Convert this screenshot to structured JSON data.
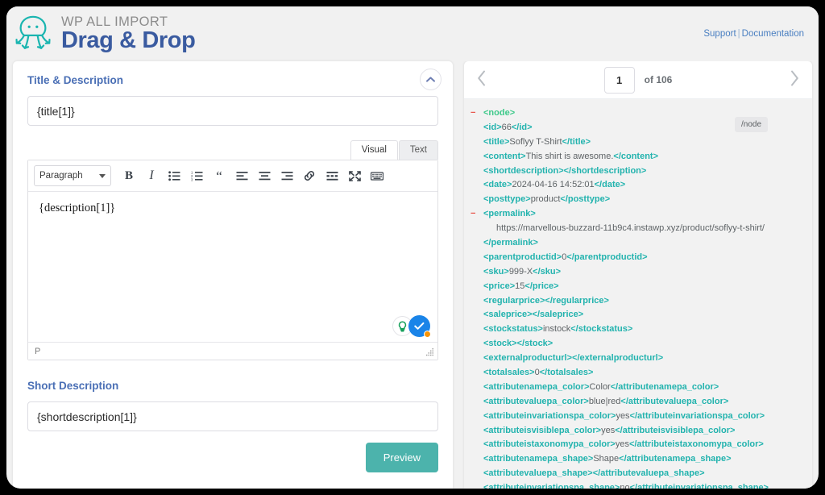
{
  "header": {
    "brand_top": "WP ALL IMPORT",
    "brand_main": "Drag & Drop",
    "logo_icon": "octopus-icon",
    "support_label": "Support",
    "separator": "|",
    "documentation_label": "Documentation"
  },
  "left_panel": {
    "section_title": "Title & Description",
    "collapse_icon": "chevron-up-icon",
    "title_field": {
      "value": "{title[1]}",
      "placeholder": ""
    },
    "editor": {
      "tabs": [
        {
          "label": "Visual",
          "active": true
        },
        {
          "label": "Text",
          "active": false
        }
      ],
      "format_select": {
        "value": "Paragraph",
        "caret_icon": "chevron-down-icon"
      },
      "toolbar_buttons": [
        {
          "name": "bold-icon",
          "label": "B"
        },
        {
          "name": "italic-icon",
          "label": "I"
        },
        {
          "name": "bulleted-list-icon",
          "label": ""
        },
        {
          "name": "numbered-list-icon",
          "label": ""
        },
        {
          "name": "blockquote-icon",
          "label": "“"
        },
        {
          "name": "align-left-icon",
          "label": ""
        },
        {
          "name": "align-center-icon",
          "label": ""
        },
        {
          "name": "align-right-icon",
          "label": ""
        },
        {
          "name": "link-icon",
          "label": ""
        },
        {
          "name": "insert-read-more-icon",
          "label": ""
        },
        {
          "name": "fullscreen-icon",
          "label": ""
        },
        {
          "name": "toolbar-toggle-icon",
          "label": ""
        }
      ],
      "content": "{description[1]}",
      "grammarly_bulb_icon": "lightbulb-icon",
      "grammarly_check_icon": "check-circle-icon",
      "status_path": "P",
      "resize_handle_icon": "resize-grip-icon"
    },
    "short_description_title": "Short Description",
    "short_description_field": {
      "value": "{shortdescription[1]}",
      "placeholder": ""
    },
    "preview_label": "Preview"
  },
  "right_panel": {
    "prev_icon": "chevron-left-icon",
    "next_icon": "chevron-right-icon",
    "page_value": "1",
    "of_label": "of 106",
    "node_badge": "/node",
    "xml_lines": [
      {
        "indent": 0,
        "minus": true,
        "parts": [
          {
            "t": "tag-node",
            "s": "<node>"
          }
        ]
      },
      {
        "indent": 1,
        "minus": false,
        "parts": [
          {
            "t": "tag",
            "s": "<id>"
          },
          {
            "t": "txt",
            "s": "66"
          },
          {
            "t": "tag",
            "s": "</id>"
          }
        ]
      },
      {
        "indent": 1,
        "minus": false,
        "parts": [
          {
            "t": "tag",
            "s": "<title>"
          },
          {
            "t": "txt",
            "s": "Soflyy T-Shirt"
          },
          {
            "t": "tag",
            "s": "</title>"
          }
        ]
      },
      {
        "indent": 1,
        "minus": false,
        "parts": [
          {
            "t": "tag",
            "s": "<content>"
          },
          {
            "t": "txt",
            "s": "This shirt is awesome."
          },
          {
            "t": "tag",
            "s": "</content>"
          }
        ]
      },
      {
        "indent": 1,
        "minus": false,
        "parts": [
          {
            "t": "tag",
            "s": "<shortdescription></shortdescription>"
          }
        ]
      },
      {
        "indent": 1,
        "minus": false,
        "parts": [
          {
            "t": "tag",
            "s": "<date>"
          },
          {
            "t": "txt",
            "s": "2024-04-16 14:52:01"
          },
          {
            "t": "tag",
            "s": "</date>"
          }
        ]
      },
      {
        "indent": 1,
        "minus": false,
        "parts": [
          {
            "t": "tag",
            "s": "<posttype>"
          },
          {
            "t": "txt",
            "s": "product"
          },
          {
            "t": "tag",
            "s": "</posttype>"
          }
        ]
      },
      {
        "indent": 0,
        "minus": true,
        "parts": [
          {
            "t": "tag",
            "s": "<permalink>"
          }
        ],
        "pad": 1
      },
      {
        "indent": 2,
        "minus": false,
        "parts": [
          {
            "t": "txt",
            "s": "https://marvellous-buzzard-11b9c4.instawp.xyz/product/soflyy-t-shirt/"
          }
        ]
      },
      {
        "indent": 1,
        "minus": false,
        "parts": [
          {
            "t": "tag",
            "s": "</permalink>"
          }
        ]
      },
      {
        "indent": 1,
        "minus": false,
        "parts": [
          {
            "t": "tag",
            "s": "<parentproductid>"
          },
          {
            "t": "txt",
            "s": "0"
          },
          {
            "t": "tag",
            "s": "</parentproductid>"
          }
        ]
      },
      {
        "indent": 1,
        "minus": false,
        "parts": [
          {
            "t": "tag",
            "s": "<sku>"
          },
          {
            "t": "txt",
            "s": "999-X"
          },
          {
            "t": "tag",
            "s": "</sku>"
          }
        ]
      },
      {
        "indent": 1,
        "minus": false,
        "parts": [
          {
            "t": "tag",
            "s": "<price>"
          },
          {
            "t": "txt",
            "s": "15"
          },
          {
            "t": "tag",
            "s": "</price>"
          }
        ]
      },
      {
        "indent": 1,
        "minus": false,
        "parts": [
          {
            "t": "tag",
            "s": "<regularprice></regularprice>"
          }
        ]
      },
      {
        "indent": 1,
        "minus": false,
        "parts": [
          {
            "t": "tag",
            "s": "<saleprice></saleprice>"
          }
        ]
      },
      {
        "indent": 1,
        "minus": false,
        "parts": [
          {
            "t": "tag",
            "s": "<stockstatus>"
          },
          {
            "t": "txt",
            "s": "instock"
          },
          {
            "t": "tag",
            "s": "</stockstatus>"
          }
        ]
      },
      {
        "indent": 1,
        "minus": false,
        "parts": [
          {
            "t": "tag",
            "s": "<stock></stock>"
          }
        ]
      },
      {
        "indent": 1,
        "minus": false,
        "parts": [
          {
            "t": "tag",
            "s": "<externalproducturl></externalproducturl>"
          }
        ]
      },
      {
        "indent": 1,
        "minus": false,
        "parts": [
          {
            "t": "tag",
            "s": "<totalsales>"
          },
          {
            "t": "txt",
            "s": "0"
          },
          {
            "t": "tag",
            "s": "</totalsales>"
          }
        ]
      },
      {
        "indent": 1,
        "minus": false,
        "parts": [
          {
            "t": "tag",
            "s": "<attributenamepa_color>"
          },
          {
            "t": "txt",
            "s": "Color"
          },
          {
            "t": "tag",
            "s": "</attributenamepa_color>"
          }
        ]
      },
      {
        "indent": 1,
        "minus": false,
        "parts": [
          {
            "t": "tag",
            "s": "<attributevaluepa_color>"
          },
          {
            "t": "txt",
            "s": "blue|red"
          },
          {
            "t": "tag",
            "s": "</attributevaluepa_color>"
          }
        ]
      },
      {
        "indent": 1,
        "minus": false,
        "parts": [
          {
            "t": "tag",
            "s": "<attributeinvariationspa_color>"
          },
          {
            "t": "txt",
            "s": "yes"
          },
          {
            "t": "tag",
            "s": "</attributeinvariationspa_color>"
          }
        ]
      },
      {
        "indent": 1,
        "minus": false,
        "parts": [
          {
            "t": "tag",
            "s": "<attributeisvisiblepa_color>"
          },
          {
            "t": "txt",
            "s": "yes"
          },
          {
            "t": "tag",
            "s": "</attributeisvisiblepa_color>"
          }
        ]
      },
      {
        "indent": 1,
        "minus": false,
        "parts": [
          {
            "t": "tag",
            "s": "<attributeistaxonomypa_color>"
          },
          {
            "t": "txt",
            "s": "yes"
          },
          {
            "t": "tag",
            "s": "</attributeistaxonomypa_color>"
          }
        ]
      },
      {
        "indent": 1,
        "minus": false,
        "parts": [
          {
            "t": "tag",
            "s": "<attributenamepa_shape>"
          },
          {
            "t": "txt",
            "s": "Shape"
          },
          {
            "t": "tag",
            "s": "</attributenamepa_shape>"
          }
        ]
      },
      {
        "indent": 1,
        "minus": false,
        "parts": [
          {
            "t": "tag",
            "s": "<attributevaluepa_shape></attributevaluepa_shape>"
          }
        ]
      },
      {
        "indent": 1,
        "minus": false,
        "parts": [
          {
            "t": "tag",
            "s": "<attributeinvariationspa_shape>"
          },
          {
            "t": "txt",
            "s": "no"
          },
          {
            "t": "tag",
            "s": "</attributeinvariationspa_shape>"
          }
        ]
      }
    ]
  },
  "colors": {
    "brand_blue": "#3a5ba0",
    "teal": "#22b3ae",
    "node_green": "#3ec98a",
    "preview_button": "#4cb3ac",
    "link_blue": "#4a7fc1",
    "minus_red": "#e8544a"
  }
}
